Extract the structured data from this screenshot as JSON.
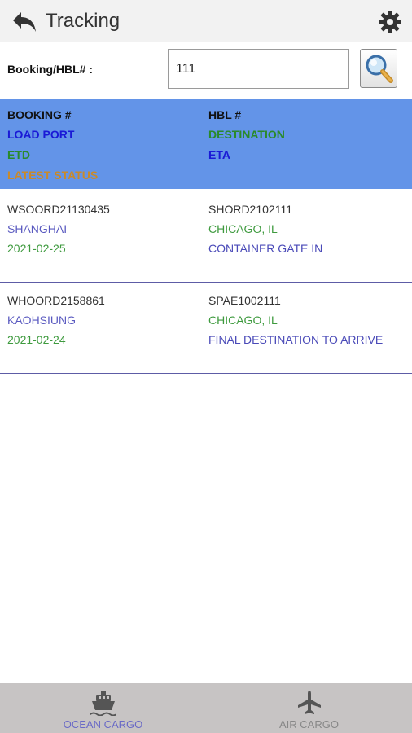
{
  "header": {
    "title": "Tracking",
    "back_icon": "back-arrow-icon",
    "settings_icon": "gear-icon"
  },
  "search": {
    "label": "Booking/HBL# :",
    "value": "111",
    "button_icon": "magnifier-icon"
  },
  "columns": {
    "booking": "BOOKING #",
    "hbl": "HBL #",
    "load_port": "LOAD PORT",
    "destination": "DESTINATION",
    "etd": "ETD",
    "eta": "ETA",
    "latest_status": "LATEST STATUS"
  },
  "colors": {
    "header_band": "#6394e8",
    "load_port_blue": "#1a1ad6",
    "destination_green": "#2a8a2a",
    "status_orange": "#c98a2a"
  },
  "results": [
    {
      "booking": "WSOORD21130435",
      "hbl": "SHORD2102111",
      "load_port": "SHANGHAI",
      "destination": "CHICAGO, IL",
      "etd": "2021-02-25",
      "status": "CONTAINER GATE IN"
    },
    {
      "booking": "WHOORD2158861",
      "hbl": "SPAE1002111",
      "load_port": "KAOHSIUNG",
      "destination": "CHICAGO, IL",
      "etd": "2021-02-24",
      "status": "FINAL DESTINATION TO ARRIVE"
    }
  ],
  "bottom_nav": {
    "ocean_label": "OCEAN CARGO",
    "ocean_icon": "ship-icon",
    "air_label": "AIR CARGO",
    "air_icon": "airplane-icon"
  }
}
